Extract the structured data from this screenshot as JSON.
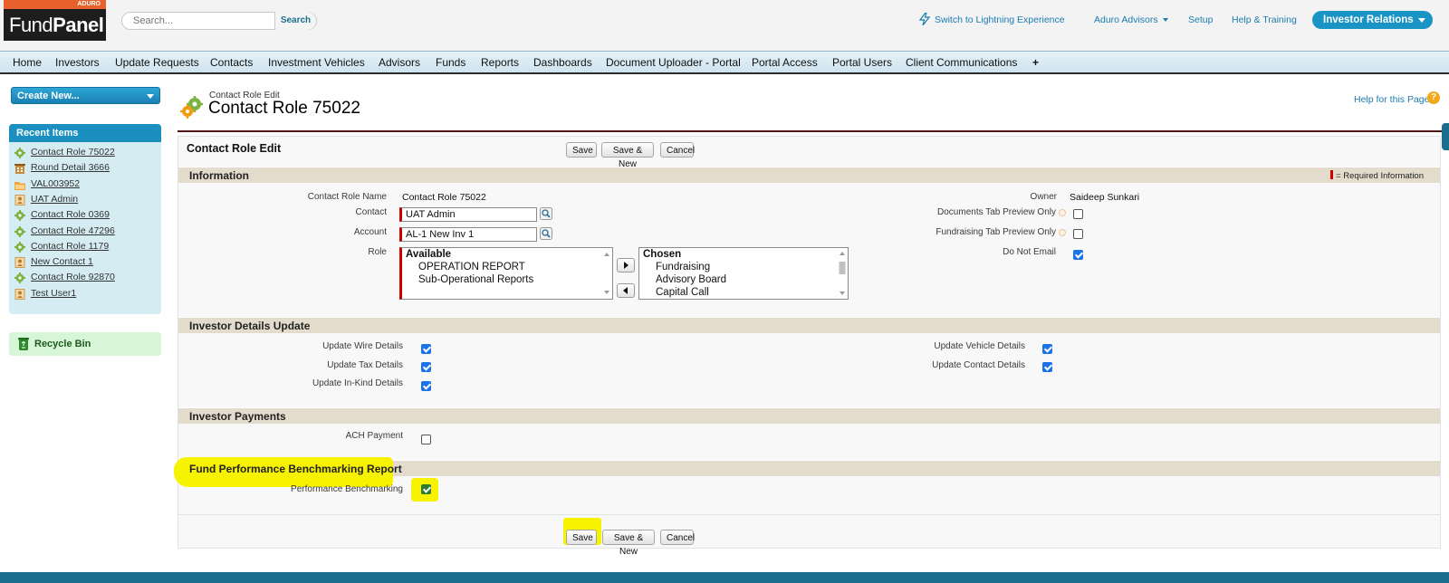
{
  "header": {
    "logo_top": "ADURO",
    "logo_fund": "Fund",
    "logo_panel": "Panel",
    "search_placeholder": "Search...",
    "search_button": "Search",
    "links": {
      "lightning": "Switch to Lightning Experience",
      "org": "Aduro Advisors",
      "setup": "Setup",
      "help": "Help & Training"
    },
    "app_menu": "Investor Relations"
  },
  "nav": {
    "tabs": [
      "Home",
      "Investors",
      "Update Requests",
      "Contacts",
      "Investment Vehicles",
      "Advisors",
      "Funds",
      "Reports",
      "Dashboards",
      "Document Uploader - Portal",
      "Portal Access",
      "Portal Users",
      "Client Communications",
      "+"
    ]
  },
  "sidebar": {
    "create_new": "Create New...",
    "recent_title": "Recent Items",
    "recent": [
      {
        "label": "Contact Role 75022",
        "icon": "gear-icon"
      },
      {
        "label": "Round Detail 3666",
        "icon": "building-icon"
      },
      {
        "label": "VAL003952",
        "icon": "folder-icon"
      },
      {
        "label": "UAT Admin",
        "icon": "contact-card-icon"
      },
      {
        "label": "Contact Role 0369",
        "icon": "gear-icon"
      },
      {
        "label": "Contact Role 47296",
        "icon": "gear-icon"
      },
      {
        "label": "Contact Role 1179",
        "icon": "gear-icon"
      },
      {
        "label": "New Contact 1",
        "icon": "contact-card-icon"
      },
      {
        "label": "Contact Role 92870",
        "icon": "gear-icon"
      },
      {
        "label": "Test User1",
        "icon": "contact-card-icon"
      }
    ],
    "recycle_bin": "Recycle Bin"
  },
  "page": {
    "type": "Contact Role Edit",
    "title": "Contact Role 75022",
    "help_link": "Help for this Page",
    "help_icon": "?"
  },
  "form": {
    "title": "Contact Role Edit",
    "buttons": {
      "save": "Save",
      "save_new": "Save & New",
      "cancel": "Cancel"
    },
    "required_info": "= Required Information",
    "sections": {
      "information": "Information",
      "investor_details": "Investor Details Update",
      "investor_payments": "Investor Payments",
      "fund_performance": "Fund Performance Benchmarking Report"
    },
    "information": {
      "name_label": "Contact Role Name",
      "name_value": "Contact Role 75022",
      "contact_label": "Contact",
      "contact_value": "UAT Admin",
      "account_label": "Account",
      "account_value": "AL-1 New Inv 1",
      "role_label": "Role",
      "available_head": "Available",
      "available": [
        "OPERATION REPORT",
        "Sub-Operational Reports"
      ],
      "chosen_head": "Chosen",
      "chosen": [
        "Fundraising",
        "Advisory Board",
        "Capital Call"
      ],
      "owner_label": "Owner",
      "owner_value": "Saideep Sunkari",
      "docs_tab_label": "Documents Tab Preview Only",
      "docs_tab_checked": false,
      "fundraising_tab_label": "Fundraising Tab Preview Only",
      "fundraising_tab_checked": false,
      "do_not_email_label": "Do Not Email",
      "do_not_email_checked": true
    },
    "investor_details": {
      "wire_label": "Update Wire Details",
      "wire_checked": true,
      "tax_label": "Update Tax Details",
      "tax_checked": true,
      "inkind_label": "Update In-Kind Details",
      "inkind_checked": true,
      "vehicle_label": "Update Vehicle Details",
      "vehicle_checked": true,
      "contact_label": "Update Contact Details",
      "contact_checked": true
    },
    "investor_payments": {
      "ach_label": "ACH Payment",
      "ach_checked": false
    },
    "fund_performance": {
      "bench_label": "Performance Benchmarking",
      "bench_checked": true
    }
  },
  "colors": {
    "accent": "#1a94c4",
    "highlight": "#f7f200",
    "section_bg": "#e3dccd",
    "required": "#cc0000"
  }
}
